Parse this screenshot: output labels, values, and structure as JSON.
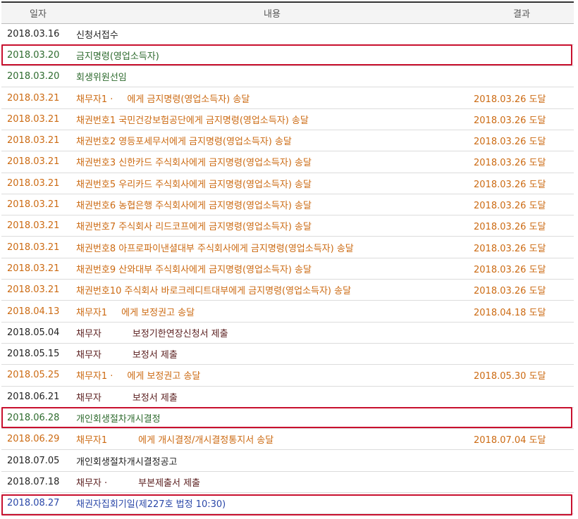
{
  "header": {
    "date": "일자",
    "content": "내용",
    "result": "결과"
  },
  "rows": [
    {
      "date": "2018.03.16",
      "content": "신청서접수",
      "result": ""
    },
    {
      "date": "2018.03.20",
      "content": "금지명령(영업소득자)",
      "result": ""
    },
    {
      "date": "2018.03.20",
      "content": "회생위원선임",
      "result": ""
    },
    {
      "date": "2018.03.21",
      "content_a": "채무자1 ·",
      "content_b": "에게 금지명령(영업소득자) 송달",
      "result": "2018.03.26 도달"
    },
    {
      "date": "2018.03.21",
      "content": "채권번호1 국민건강보험공단에게 금지명령(영업소득자) 송달",
      "result": "2018.03.26 도달"
    },
    {
      "date": "2018.03.21",
      "content": "채권번호2 영등포세무서에게 금지명령(영업소득자) 송달",
      "result": "2018.03.26 도달"
    },
    {
      "date": "2018.03.21",
      "content": "채권번호3 신한카드 주식회사에게 금지명령(영업소득자) 송달",
      "result": "2018.03.26 도달"
    },
    {
      "date": "2018.03.21",
      "content": "채권번호5 우리카드 주식회사에게 금지명령(영업소득자) 송달",
      "result": "2018.03.26 도달"
    },
    {
      "date": "2018.03.21",
      "content": "채권번호6 농협은행 주식회사에게 금지명령(영업소득자) 송달",
      "result": "2018.03.26 도달"
    },
    {
      "date": "2018.03.21",
      "content": "채권번호7 주식회사 리드코프에게 금지명령(영업소득자) 송달",
      "result": "2018.03.26 도달"
    },
    {
      "date": "2018.03.21",
      "content": "채권번호8 아프로파이낸셜대부 주식회사에게 금지명령(영업소득자) 송달",
      "result": "2018.03.26 도달"
    },
    {
      "date": "2018.03.21",
      "content": "채권번호9 산와대부 주식회사에게 금지명령(영업소득자) 송달",
      "result": "2018.03.26 도달"
    },
    {
      "date": "2018.03.21",
      "content": "채권번호10 주식회사 바로크레디트대부에게 금지명령(영업소득자) 송달",
      "result": "2018.03.26 도달"
    },
    {
      "date": "2018.04.13",
      "content_a": "채무자1",
      "content_b": "에게 보정권고 송달",
      "result": "2018.04.18 도달"
    },
    {
      "date": "2018.05.04",
      "content_a": "채무자",
      "content_b": "보정기한연장신청서 제출",
      "result": ""
    },
    {
      "date": "2018.05.15",
      "content_a": "채무자",
      "content_b": "보정서 제출",
      "result": ""
    },
    {
      "date": "2018.05.25",
      "content_a": "채무자1 ·",
      "content_b": "에게 보정권고 송달",
      "result": "2018.05.30 도달"
    },
    {
      "date": "2018.06.21",
      "content_a": "채무자",
      "content_b": "보정서 제출",
      "result": ""
    },
    {
      "date": "2018.06.28",
      "content": "개인회생절차개시결정",
      "result": ""
    },
    {
      "date": "2018.06.29",
      "content_a": "채무자1",
      "content_b": "에게 개시결정/개시결정통지서 송달",
      "result": "2018.07.04 도달"
    },
    {
      "date": "2018.07.05",
      "content": "개인회생절차개시결정공고",
      "result": ""
    },
    {
      "date": "2018.07.18",
      "content_a": "채무자 ·",
      "content_b": "부본제출서 제출",
      "result": ""
    },
    {
      "date": "2018.08.27",
      "content": "채권자집회기일(제227호 법정 10:30)",
      "result": ""
    }
  ],
  "colors": {
    "default": "#222222",
    "green": "#2e6b2e",
    "orange": "#cc6a12",
    "maroon": "#5a1e1e",
    "blue": "#2a47a8",
    "highlight_border": "#c8102e"
  }
}
